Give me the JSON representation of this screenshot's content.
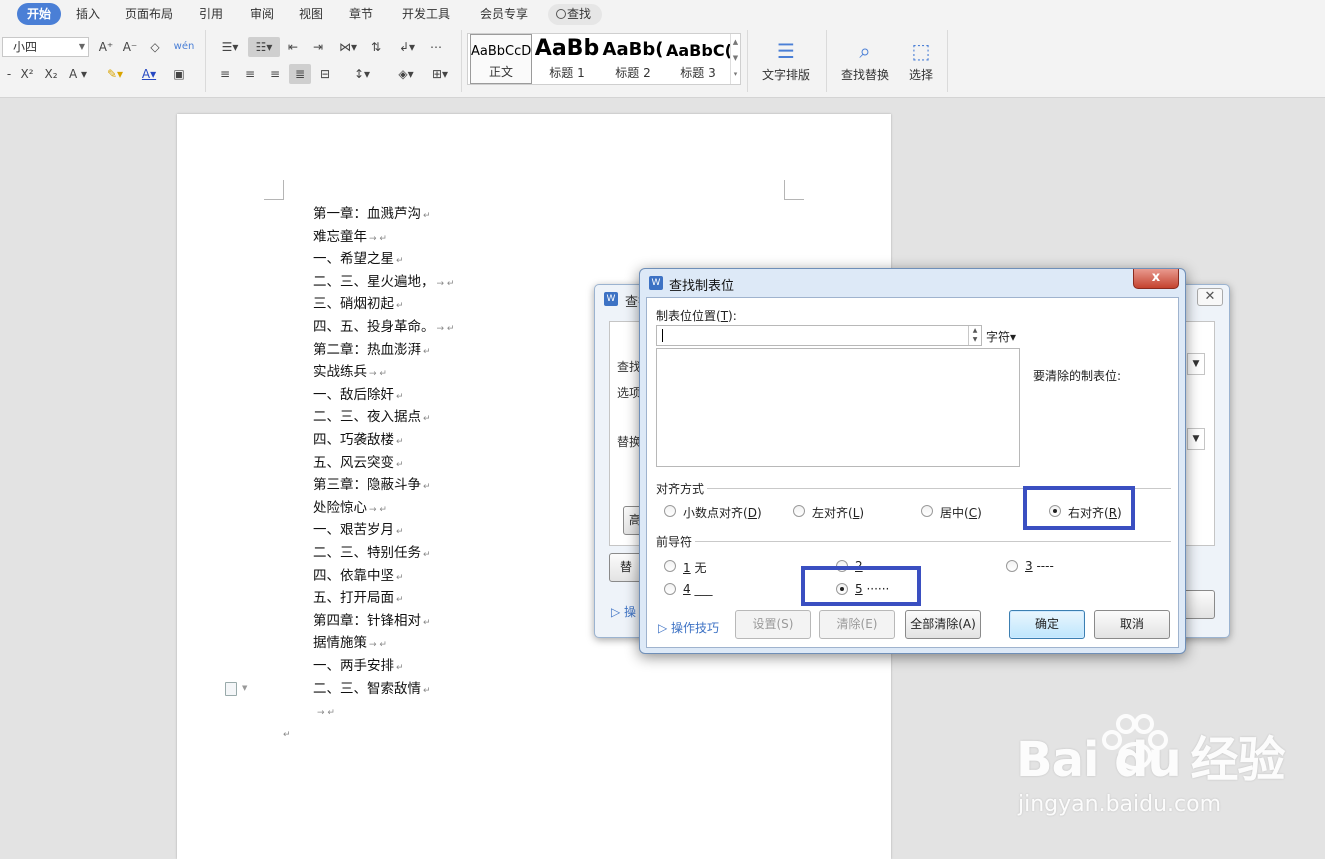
{
  "ribbon": {
    "tabs": [
      "开始",
      "插入",
      "页面布局",
      "引用",
      "审阅",
      "视图",
      "章节",
      "开发工具",
      "会员专享"
    ],
    "search": "查找",
    "font_size": "小四",
    "styles": [
      {
        "preview": "AaBbCcD",
        "name": "正文"
      },
      {
        "preview": "AaBb",
        "name": "标题 1"
      },
      {
        "preview": "AaBb(",
        "name": "标题 2"
      },
      {
        "preview": "AaBbC(",
        "name": "标题 3"
      }
    ],
    "text_layout": "文字排版",
    "find_replace": "查找替换",
    "select": "选择"
  },
  "document": {
    "lines": [
      "第一章：血溅芦沟",
      "难忘童年",
      "一、希望之星",
      "二、三、星火遍地，",
      "三、硝烟初起",
      "四、五、投身革命。",
      "第二章：热血澎湃",
      "实战练兵",
      "一、敌后除奸",
      "二、三、夜入据点",
      "四、巧袭敌楼",
      "五、风云突变",
      "第三章：隐蔽斗争",
      "处险惊心",
      "一、艰苦岁月",
      "二、三、特别任务",
      "四、依靠中坚",
      "五、打开局面",
      "第四章：针锋相对",
      "据情施策",
      "一、两手安排",
      "二、三、智索敌情"
    ]
  },
  "back_dialog": {
    "title": "查找",
    "tab": "查找",
    "find_label": "查找",
    "options_label": "选项",
    "replace_label": "替换",
    "advanced_button": "高",
    "replace_button": "替",
    "tips": "操"
  },
  "tab_dialog": {
    "title": "查找制表位",
    "position_label": "制表位位置",
    "position_key": "T",
    "unit": "字符",
    "clear_label": "要清除的制表位:",
    "alignment_group": "对齐方式",
    "alignments": [
      {
        "label": "小数点对齐",
        "key": "D"
      },
      {
        "label": "左对齐",
        "key": "L"
      },
      {
        "label": "居中",
        "key": "C"
      },
      {
        "label": "右对齐",
        "key": "R"
      }
    ],
    "selected_alignment": "右对齐",
    "leader_group": "前导符",
    "leaders": [
      {
        "key": "1",
        "text": " 无"
      },
      {
        "key": "2",
        "text": ""
      },
      {
        "key": "3",
        "text": " ----"
      },
      {
        "key": "4",
        "text": " ___"
      },
      {
        "key": "5",
        "text": " ······"
      }
    ],
    "selected_leader": "5",
    "tips": "操作技巧",
    "buttons": {
      "set": "设置(S)",
      "clear": "清除(E)",
      "clear_all": "全部清除(A)",
      "ok": "确定",
      "cancel": "取消"
    },
    "close": "x"
  },
  "watermark": {
    "brand": "Bai  du",
    "cn": "经验",
    "url": "jingyan.baidu.com"
  },
  "colors": {
    "accent": "#4a7fd6",
    "highlight_box": "#3a4fc1"
  }
}
